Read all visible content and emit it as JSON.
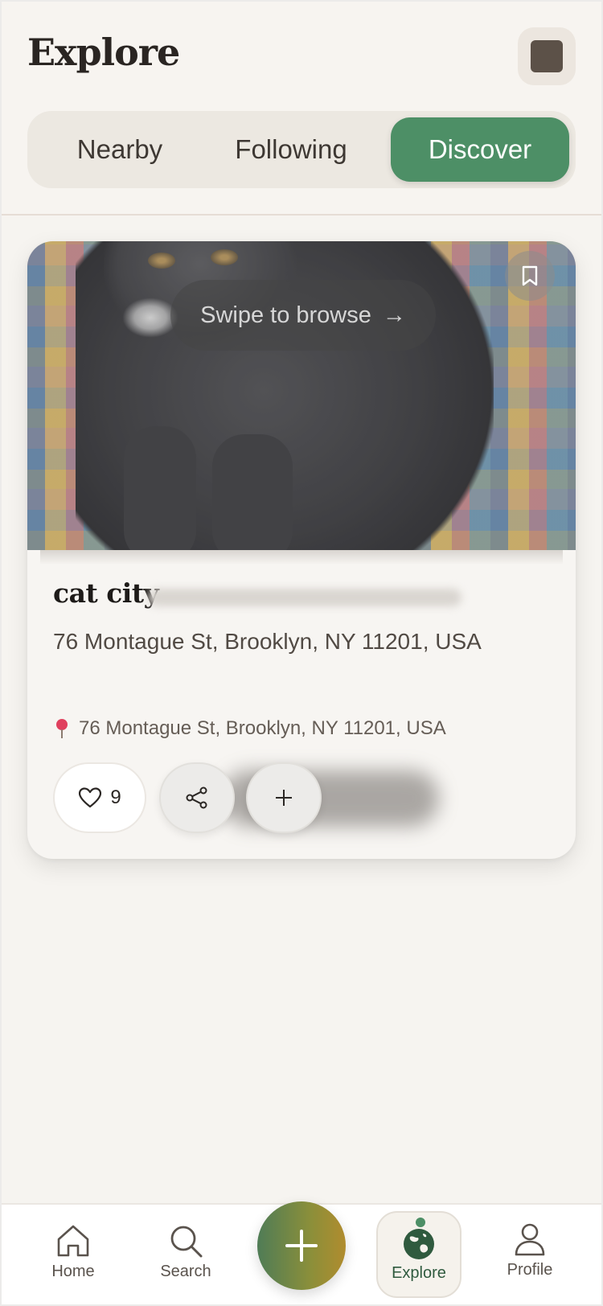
{
  "header": {
    "title": "Explore",
    "tabs": [
      {
        "label": "Nearby",
        "active": false
      },
      {
        "label": "Following",
        "active": false
      },
      {
        "label": "Discover",
        "active": true
      }
    ]
  },
  "card": {
    "swipe_hint": "Swipe to browse",
    "swipe_arrow": "→",
    "title": "cat city",
    "address": "76 Montague St, Brooklyn, NY 11201, USA",
    "location": "76 Montague St, Brooklyn, NY 11201, USA",
    "likes": "9"
  },
  "nav": {
    "items": [
      {
        "label": "Home",
        "icon": "home-icon"
      },
      {
        "label": "Search",
        "icon": "search-icon"
      },
      {
        "label": "Explore",
        "icon": "globe-icon",
        "active": true
      },
      {
        "label": "Profile",
        "icon": "profile-icon"
      }
    ]
  },
  "colors": {
    "accent": "#4d8f66",
    "background": "#f6f4f0",
    "fab_gradient_start": "#4f7c56",
    "fab_gradient_end": "#b08c2e"
  }
}
